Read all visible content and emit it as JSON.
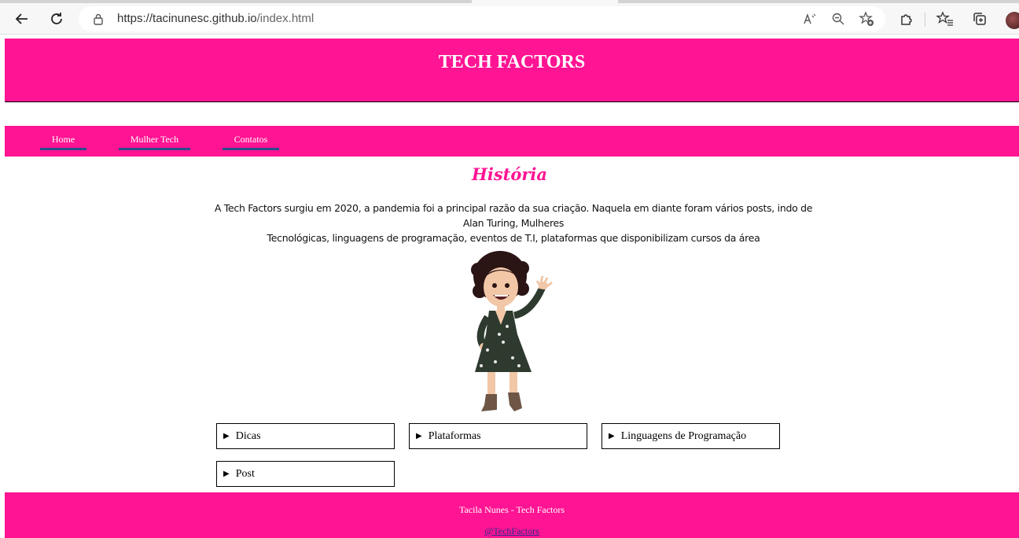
{
  "browser": {
    "url_host": "https://tacinunesc.github.io",
    "url_path": "/index.html"
  },
  "icons": {
    "back": "arrow-left-icon",
    "reload": "reload-icon",
    "lock": "lock-icon",
    "read_aloud": "read-aloud-icon",
    "zoom": "zoom-out-icon",
    "favorite": "add-favorite-icon",
    "extensions": "puzzle-icon",
    "favorites": "favorites-icon",
    "collections": "collections-icon",
    "profile": "profile-avatar-icon"
  },
  "colors": {
    "brand": "#ff1493",
    "nav_underline": "#2b4d8c"
  },
  "header": {
    "title": "TECH FACTORS"
  },
  "nav": {
    "items": [
      {
        "label": "Home"
      },
      {
        "label": "Mulher Tech"
      },
      {
        "label": "Contatos"
      }
    ]
  },
  "main": {
    "heading": "História",
    "line1": "A Tech Factors surgiu em 2020, a pandemia foi a principal razão da sua criação. Naquela em diante foram vários posts, indo de Alan Turing, Mulheres",
    "line2": "Tecnológicas, linguagens de programação, eventos de T.I, plataformas que disponibilizam cursos da área",
    "details": [
      {
        "label": "Dicas"
      },
      {
        "label": "Plataformas"
      },
      {
        "label": "Linguagens de Programação"
      },
      {
        "label": "Post"
      }
    ]
  },
  "footer": {
    "credit": "Tacila Nunes - Tech Factors",
    "handle": "@TechFactors"
  }
}
